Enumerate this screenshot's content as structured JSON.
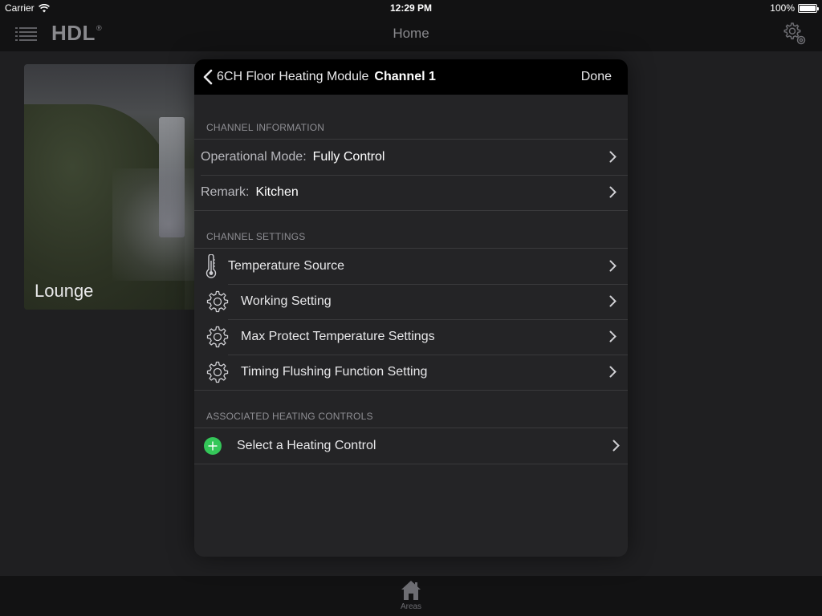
{
  "status_bar": {
    "carrier": "Carrier",
    "time": "12:29 PM",
    "battery": "100%",
    "battery_level": 1.0
  },
  "nav": {
    "logo": "HDL",
    "logo_mark": "®",
    "title": "Home",
    "menu_icon": "list-icon",
    "settings_icon": "gear-icon"
  },
  "background": {
    "area_card_label": "Lounge"
  },
  "tab_bar": {
    "items": [
      {
        "label": "Areas",
        "icon": "house-icon"
      }
    ]
  },
  "modal": {
    "back_label": "6CH Floor Heating Module",
    "title": "Channel 1",
    "done_label": "Done",
    "sections": [
      {
        "header": "CHANNEL INFORMATION",
        "rows": [
          {
            "label": "Operational Mode:",
            "value": "Fully Control"
          },
          {
            "label": "Remark:",
            "value": "Kitchen"
          }
        ]
      },
      {
        "header": "CHANNEL SETTINGS",
        "rows": [
          {
            "label": "Temperature Source",
            "icon": "thermometer-icon"
          },
          {
            "label": "Working Setting",
            "icon": "gear-icon"
          },
          {
            "label": "Max Protect Temperature Settings",
            "icon": "gear-icon"
          },
          {
            "label": "Timing Flushing Function Setting",
            "icon": "gear-icon"
          }
        ]
      },
      {
        "header": "ASSOCIATED HEATING CONTROLS",
        "rows": [
          {
            "label": "Select a Heating Control",
            "icon": "add-circle-icon"
          }
        ]
      }
    ]
  },
  "colors": {
    "accent_green": "#34c759",
    "background": "#1c1c1e",
    "modal_background": "#242426",
    "header_black": "#000000"
  }
}
